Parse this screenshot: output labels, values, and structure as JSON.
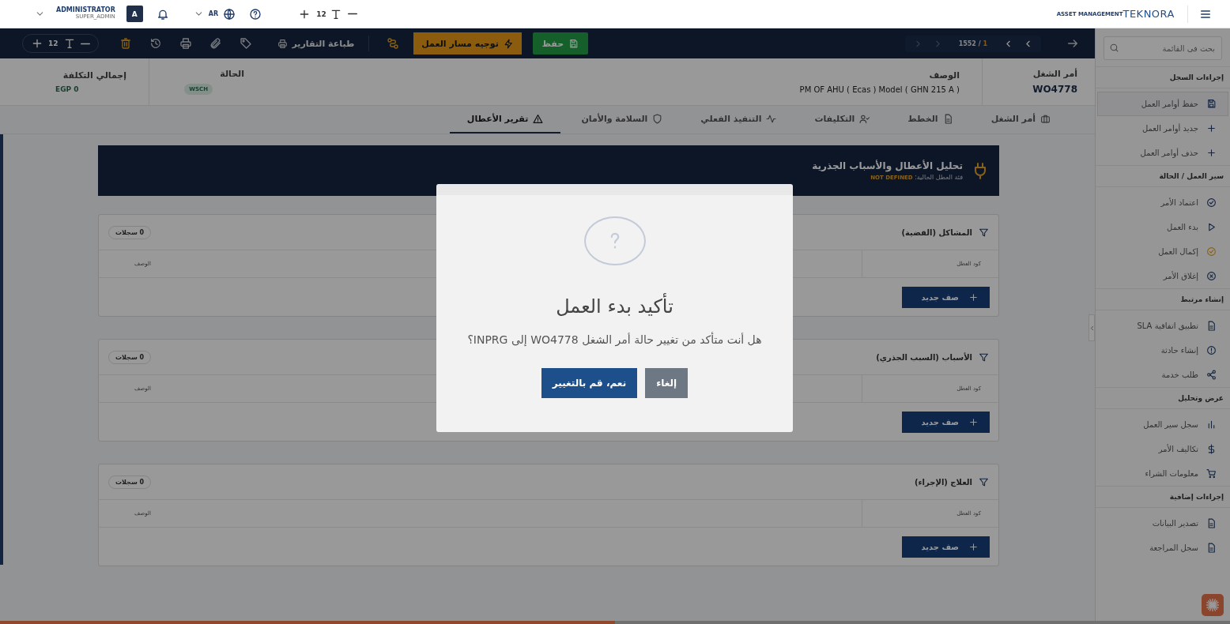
{
  "topbar": {
    "user_name": "ADMINISTRATOR",
    "user_role": "SUPER_ADMIN",
    "avatar": "A",
    "language": "AR",
    "font_size": "12",
    "logo_tagline": "ASSET MANAGEMENT",
    "logo_brand": "TEKNORA"
  },
  "toolbar": {
    "font_size": "12",
    "print_label": "طباعة التقارير",
    "route_label": "توجيه مسار العمل",
    "save_label": "حفظ",
    "pager_current": "1",
    "pager_separator": "/",
    "pager_total": "1552"
  },
  "header": {
    "primary": [
      {
        "label": "أمر الشغل",
        "value": "WO4778",
        "kind": "code"
      },
      {
        "label": "الوصف",
        "value": "PM OF AHU  ( Ecas ) Model ( GHN 215 A )",
        "kind": "text"
      }
    ],
    "secondary": [
      {
        "label": "الحالة",
        "value": "WSCH",
        "kind": "badge"
      },
      {
        "label": "إجمالي التكلفة",
        "value": "EGP 0",
        "kind": "money"
      }
    ]
  },
  "tabs": [
    {
      "label": "أمر الشغل",
      "selected": false
    },
    {
      "label": "الخطط",
      "selected": false
    },
    {
      "label": "التكليفات",
      "selected": false
    },
    {
      "label": "التنفيذ الفعلي",
      "selected": false
    },
    {
      "label": "السلامة والأمان",
      "selected": false
    },
    {
      "label": "تقرير الأعطال",
      "selected": true
    }
  ],
  "banner": {
    "title": "تحليل الأعطال والأسباب الجذرية",
    "subtitle": "فئة العطل الحالية:",
    "category": "NOT DEFINED"
  },
  "panels": [
    {
      "title": "المشاكل (القضية)",
      "count": "0 سجلات",
      "columns": [
        "كود العطل",
        "الوصف"
      ],
      "add_label": "صف جديد"
    },
    {
      "title": "الأسباب (السبب الجذري)",
      "count": "0 سجلات",
      "columns": [
        "كود العطل",
        "الوصف"
      ],
      "add_label": "صف جديد"
    },
    {
      "title": "العلاج (الإجراء)",
      "count": "0 سجلات",
      "columns": [
        "كود العطل",
        "الوصف"
      ],
      "add_label": "صف جديد"
    }
  ],
  "sidebar": {
    "search_placeholder": "بحث في القائمة",
    "sections": [
      {
        "title": "إجراءات السجل",
        "items": [
          {
            "label": "حفظ أوامر العمل",
            "selected": true
          },
          {
            "label": "جديد أوامر العمل",
            "selected": false
          },
          {
            "label": "حذف أوامر العمل",
            "selected": false
          }
        ]
      },
      {
        "title": "سير العمل / الحالة",
        "items": [
          {
            "label": "اعتماد الأمر",
            "selected": false
          },
          {
            "label": "بدء العمل",
            "selected": false
          },
          {
            "label": "إكمال العمل",
            "selected": false
          },
          {
            "label": "إغلاق الأمر",
            "selected": false
          }
        ]
      },
      {
        "title": "إنشاء مرتبط",
        "items": [
          {
            "label": "تطبيق اتفاقية SLA",
            "selected": false
          },
          {
            "label": "إنشاء حادثة",
            "selected": false
          },
          {
            "label": "طلب خدمة",
            "selected": false
          }
        ]
      },
      {
        "title": "عرض وتحليل",
        "items": [
          {
            "label": "سجل سير العمل",
            "selected": false
          },
          {
            "label": "تكاليف الأمر",
            "selected": false
          },
          {
            "label": "معلومات الشراء",
            "selected": false
          }
        ]
      },
      {
        "title": "إجراءات إضافية",
        "items": [
          {
            "label": "تصدير البيانات",
            "selected": false
          },
          {
            "label": "سجل المراجعة",
            "selected": false
          }
        ]
      }
    ]
  },
  "modal": {
    "title": "تأكيد بدء العمل",
    "message": "هل أنت متأكد من تغيير حالة أمر الشغل WO4778 إلى INPRG؟",
    "confirm_label": "نعم، قم بالتغيير",
    "cancel_label": "إلغاء"
  },
  "progress": {
    "level": 0.5
  }
}
